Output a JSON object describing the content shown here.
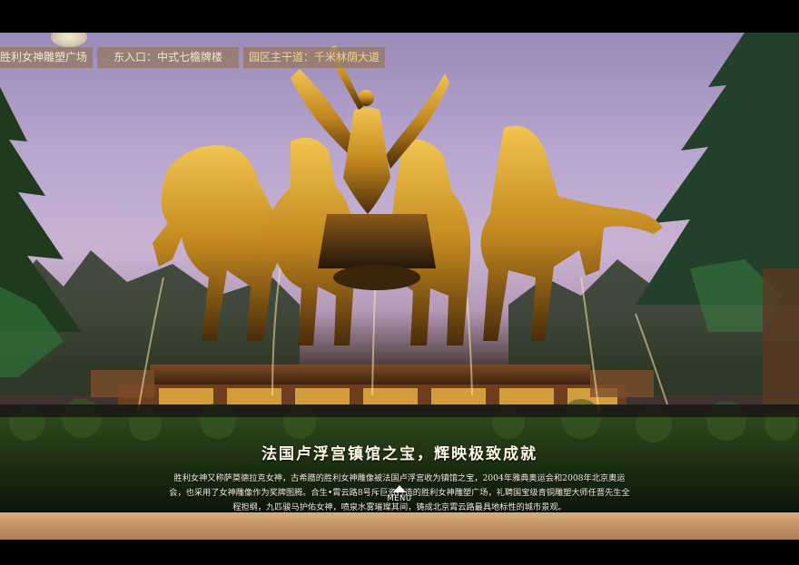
{
  "nav": {
    "tabs": [
      {
        "label": "胜利女神雕塑广场"
      },
      {
        "label": "东入口：中式七檐牌楼"
      },
      {
        "label": "园区主干道：千米林荫大道"
      }
    ]
  },
  "caption": {
    "title": "法国卢浮宫镇馆之宝，辉映极致成就",
    "body": "胜利女神又称萨莫德拉克女神，古希腊的胜利女神雕像被法国卢浮宫收为镇馆之宝，2004年雅典奥运会和2008年北京奥运会，也采用了女神雕像作为奖牌图腾。合生•霄云路8号斥巨资打造的胜利女神雕塑广场，礼聘国宝级青铜雕塑大师任晋先生全程担纲，九匹骏马护佑女神，喷泉水雾璀璨其间，铸成北京霄云路最具地标性的城市景观。"
  },
  "menu": {
    "label": "MENU"
  },
  "colors": {
    "tab_bg": "#96785f",
    "gold": "#d8a530",
    "bottom_bar": "#c49466"
  }
}
